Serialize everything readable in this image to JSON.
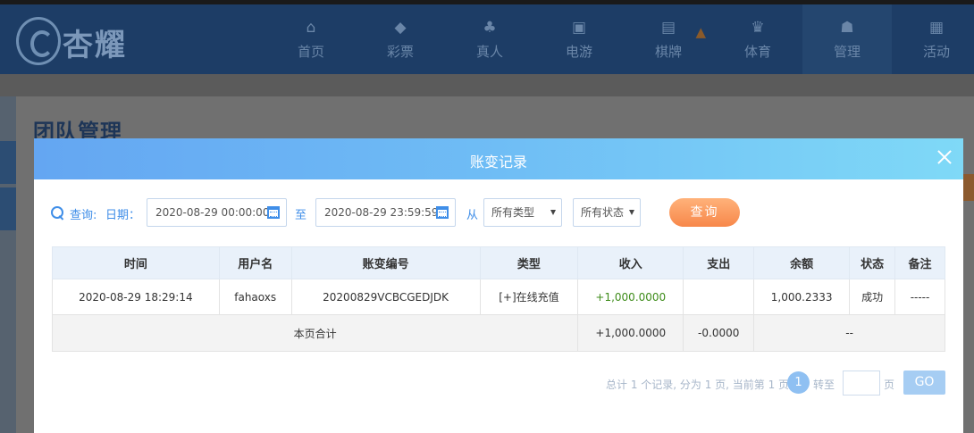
{
  "logo": {
    "text": "杏耀"
  },
  "nav": [
    {
      "label": "首页",
      "icon": "home-icon",
      "glyph": "⌂"
    },
    {
      "label": "彩票",
      "icon": "ticket-icon",
      "glyph": "◆"
    },
    {
      "label": "真人",
      "icon": "live-dealer-icon",
      "glyph": "♣"
    },
    {
      "label": "电游",
      "icon": "slot-machine-icon",
      "glyph": "▣"
    },
    {
      "label": "棋牌",
      "icon": "cards-icon",
      "glyph": "▤"
    },
    {
      "label": "体育",
      "icon": "trophy-icon",
      "glyph": "♛"
    },
    {
      "label": "管理",
      "icon": "users-icon",
      "glyph": "☗"
    },
    {
      "label": "活动",
      "icon": "gift-icon",
      "glyph": "▦"
    }
  ],
  "page": {
    "title": "团队管理"
  },
  "modal": {
    "title": "账变记录",
    "filter": {
      "query_label": "查询:",
      "date_label": "日期：",
      "start_date": "2020-08-29 00:00:00",
      "to_label": "至",
      "end_date": "2020-08-29 23:59:59",
      "from_label": "从",
      "type_select": "所有类型",
      "status_select": "所有状态",
      "query_button": "查询"
    },
    "table": {
      "headers": [
        "时间",
        "用户名",
        "账变编号",
        "类型",
        "收入",
        "支出",
        "余额",
        "状态",
        "备注"
      ],
      "rows": [
        [
          "2020-08-29 18:29:14",
          "fahaoxs",
          "20200829VCBCGEDJDK",
          "[+]在线充值",
          "+1,000.0000",
          "",
          "1,000.2333",
          "成功",
          "-----"
        ]
      ],
      "total": {
        "label": "本页合计",
        "income": "+1,000.0000",
        "expense": "-0.0000",
        "balance": "--"
      }
    },
    "pagination": {
      "summary": "总计 1 个记录, 分为 1 页, 当前第 1 页",
      "current_page": "1",
      "goto_label": "转至",
      "page_suffix": "页",
      "go_button": "GO"
    }
  },
  "colors": {
    "accent": "#3f8ee8",
    "header_bg": "#1d3d66",
    "income_green": "#3e8c1a",
    "query_button": "#f7874a"
  }
}
